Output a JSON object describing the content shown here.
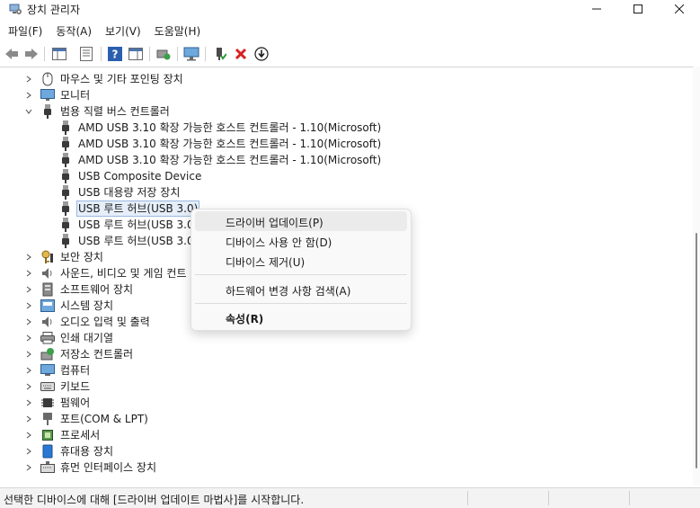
{
  "window": {
    "title": "장치 관리자",
    "buttons": [
      "minimize-icon",
      "maximize-icon",
      "close-icon"
    ]
  },
  "menu": [
    "파일(F)",
    "동작(A)",
    "보기(V)",
    "도움말(H)"
  ],
  "toolbar": {
    "icons": [
      "back-arrow-icon",
      "forward-arrow-icon",
      "show-hide-console-tree-icon",
      "properties-icon",
      "help-icon",
      "show-action-pane-icon",
      "scan-hardware-changes-icon",
      "monitor-icon",
      "enable-device-icon",
      "uninstall-device-icon",
      "update-driver-icon"
    ]
  },
  "tree": {
    "items": [
      {
        "label": "마우스 및 기타 포인팅 장치",
        "expanded": false,
        "icon": "mouse-icon"
      },
      {
        "label": "모니터",
        "expanded": false,
        "icon": "monitor-icon"
      },
      {
        "label": "범용 직렬 버스 컨트롤러",
        "expanded": true,
        "icon": "usb-icon"
      },
      {
        "label": "AMD USB 3.10 확장 가능한 호스트 컨트롤러 - 1.10(Microsoft)",
        "child": true,
        "icon": "usb-icon"
      },
      {
        "label": "AMD USB 3.10 확장 가능한 호스트 컨트롤러 - 1.10(Microsoft)",
        "child": true,
        "icon": "usb-icon"
      },
      {
        "label": "AMD USB 3.10 확장 가능한 호스트 컨트롤러 - 1.10(Microsoft)",
        "child": true,
        "icon": "usb-icon"
      },
      {
        "label": "USB Composite Device",
        "child": true,
        "icon": "usb-icon"
      },
      {
        "label": "USB 대용량 저장 장치",
        "child": true,
        "icon": "usb-icon"
      },
      {
        "label": "USB 루트 허브(USB 3.0)",
        "child": true,
        "selected": true,
        "icon": "usb-icon"
      },
      {
        "label": "USB 루트 허브(USB 3.0)",
        "child": true,
        "icon": "usb-icon"
      },
      {
        "label": "USB 루트 허브(USB 3.0)",
        "child": true,
        "icon": "usb-icon"
      },
      {
        "label": "보안 장치",
        "expanded": false,
        "icon": "security-key-icon"
      },
      {
        "label": "사운드, 비디오 및 게임 컨트",
        "expanded": false,
        "icon": "speaker-icon"
      },
      {
        "label": "소프트웨어 장치",
        "expanded": false,
        "icon": "software-device-icon"
      },
      {
        "label": "시스템 장치",
        "expanded": false,
        "icon": "system-device-icon"
      },
      {
        "label": "오디오 입력 및 출력",
        "expanded": false,
        "icon": "speaker-icon"
      },
      {
        "label": "인쇄 대기열",
        "expanded": false,
        "icon": "printer-icon"
      },
      {
        "label": "저장소 컨트롤러",
        "expanded": false,
        "icon": "storage-controller-icon"
      },
      {
        "label": "컴퓨터",
        "expanded": false,
        "icon": "computer-icon"
      },
      {
        "label": "키보드",
        "expanded": false,
        "icon": "keyboard-icon"
      },
      {
        "label": "펌웨어",
        "expanded": false,
        "icon": "firmware-icon"
      },
      {
        "label": "포트(COM & LPT)",
        "expanded": false,
        "icon": "port-icon"
      },
      {
        "label": "프로세서",
        "expanded": false,
        "icon": "processor-icon"
      },
      {
        "label": "휴대용 장치",
        "expanded": false,
        "icon": "portable-device-icon"
      },
      {
        "label": "휴먼 인터페이스 장치",
        "expanded": false,
        "icon": "hid-icon"
      }
    ]
  },
  "context_menu": {
    "items": [
      {
        "label": "드라이버 업데이트(P)",
        "hover": true
      },
      {
        "label": "디바이스 사용 안 함(D)"
      },
      {
        "label": "디바이스 제거(U)"
      },
      {
        "label": "하드웨어 변경 사항 검색(A)"
      },
      {
        "label": "속성(R)",
        "bold": true
      }
    ]
  },
  "status": "선택한 디바이스에 대해 [드라이버 업데이트 마법사]를 시작합니다.",
  "colors": {
    "selection_bg": "#e5eef9",
    "selection_border": "#9ab8e0",
    "menu_bg": "#f9f9f9",
    "status_bg": "#f3f3f3",
    "accent_blue": "#2a78d4",
    "uninstall_red": "#d92020"
  }
}
